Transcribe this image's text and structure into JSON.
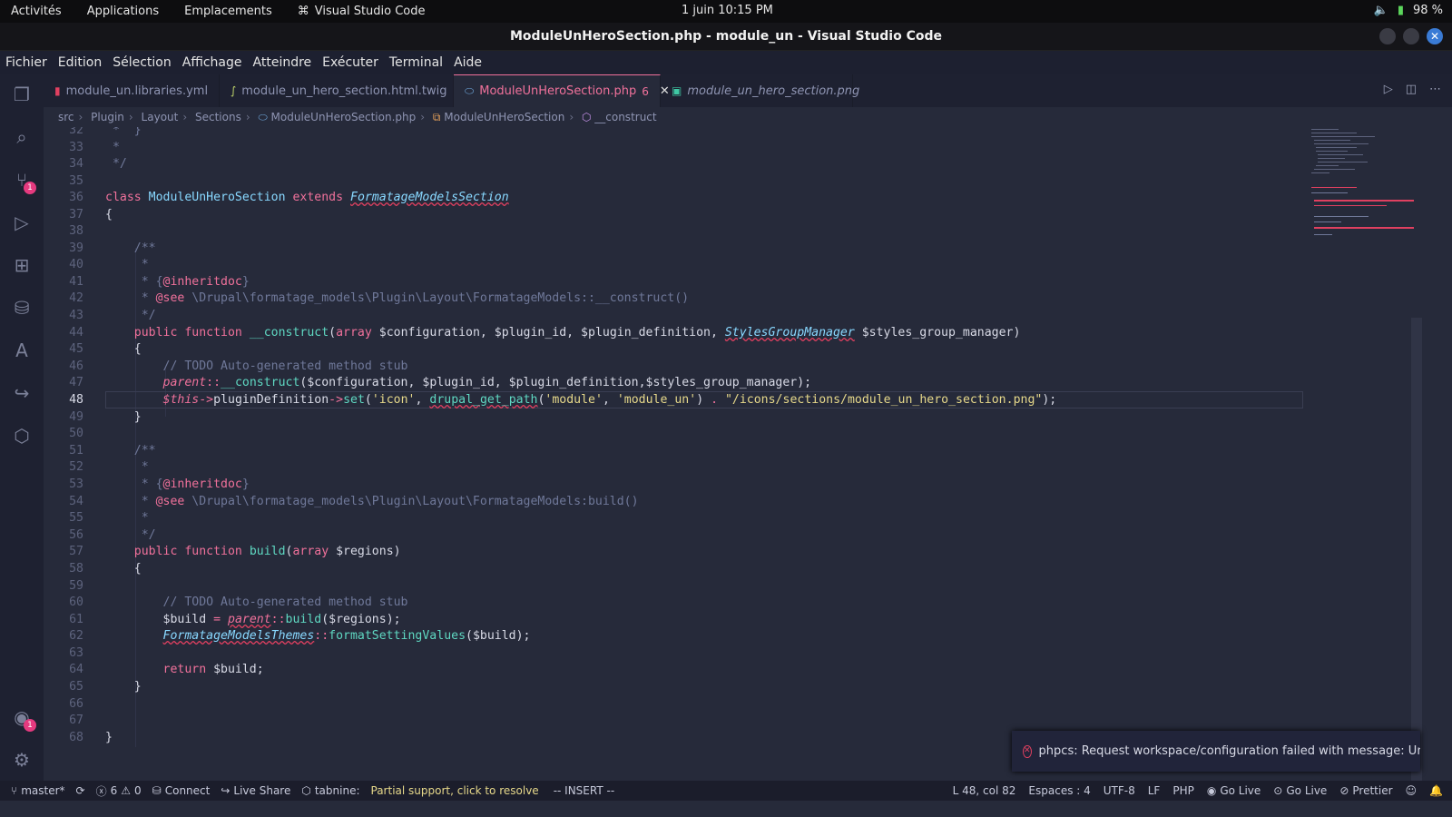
{
  "os": {
    "activities": "Activités",
    "applications": "Applications",
    "places": "Emplacements",
    "app_name": "Visual Studio Code",
    "clock": "1 juin  10:15 PM",
    "battery": "98 %"
  },
  "window": {
    "title": "ModuleUnHeroSection.php - module_un - Visual Studio Code"
  },
  "menu": [
    "Fichier",
    "Edition",
    "Sélection",
    "Affichage",
    "Atteindre",
    "Exécuter",
    "Terminal",
    "Aide"
  ],
  "activity_bar": {
    "source_control_badge": "1",
    "accounts_badge": "1"
  },
  "tabs": [
    {
      "label": "module_un.libraries.yml",
      "icon": "yaml-file-icon"
    },
    {
      "label": "module_un_hero_section.html.twig",
      "icon": "twig-file-icon"
    },
    {
      "label": "ModuleUnHeroSection.php",
      "icon": "php-file-icon",
      "problems": "6",
      "active": true
    },
    {
      "label": "module_un_hero_section.png",
      "icon": "image-file-icon"
    }
  ],
  "breadcrumb": [
    "src",
    "Plugin",
    "Layout",
    "Sections",
    "ModuleUnHeroSection.php",
    "ModuleUnHeroSection",
    "__construct"
  ],
  "editor": {
    "current_line": "48"
  },
  "notification": {
    "message": "phpcs: Request workspace/configuration failed with message: Unable..."
  },
  "status": {
    "branch": "master*",
    "errors": "6",
    "warnings": "0",
    "connect": "Connect",
    "live_share": "Live Share",
    "tabnine": "tabnine:",
    "partial": "Partial support, click to resolve",
    "mode": "-- INSERT --",
    "position": "L 48, col 82",
    "spaces": "Espaces : 4",
    "encoding": "UTF-8",
    "eol": "LF",
    "language": "PHP",
    "go_live_1": "Go Live",
    "go_live_2": "Go Live",
    "prettier": "Prettier"
  }
}
